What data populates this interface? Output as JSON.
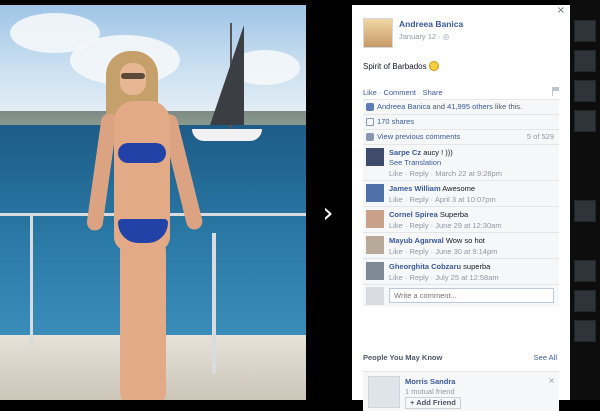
{
  "post": {
    "author": "Andreea Banica",
    "date": "January 12 · ",
    "text": "Spirit of Barbados",
    "close_glyph": "×"
  },
  "actions": {
    "like": "Like",
    "comment": "Comment",
    "share": "Share",
    "sep": " · "
  },
  "likes": {
    "name": "Andreea Banica",
    "and": " and ",
    "others": "41,995 others",
    "suffix": " like this."
  },
  "shares": {
    "label": "170 shares"
  },
  "previous": {
    "label": "View previous comments",
    "count": "5 of 529"
  },
  "comments": [
    {
      "name": "Sarpe Cz",
      "text": " aucy ! )))",
      "extra": "See Translation",
      "meta": "Like · Reply · March 22 at 9:28pm"
    },
    {
      "name": "James William",
      "text": " Awesome",
      "meta": "Like · Reply · April 3 at 10:07pm"
    },
    {
      "name": "Cornel Spirea",
      "text": " Superba",
      "meta": "Like · Reply · June 29 at 12:30am"
    },
    {
      "name": "Mayub Agarwal",
      "text": " Wow so hot",
      "meta": "Like · Reply · June 30 at 9:14pm"
    },
    {
      "name": "Gheorghita Cobzaru",
      "text": " superba",
      "meta": "Like · Reply · July 25 at 12:58am"
    }
  ],
  "composer": {
    "placeholder": "Write a comment..."
  },
  "pymk": {
    "title": "People You May Know",
    "see_all": "See All",
    "person": {
      "name": "Morris Sandra",
      "mutual": "1 mutual friend",
      "button": "Add Friend"
    }
  },
  "nav": {
    "next_glyph": "›"
  },
  "icons": [
    "close-icon",
    "globe-icon",
    "flag-icon",
    "like-icon",
    "share-icon",
    "comment-icon",
    "next-arrow-icon",
    "add-friend-icon"
  ],
  "colors": {
    "link": "#3b5998",
    "muted": "#9197a3",
    "ufi_bg": "#f6f7f9"
  }
}
